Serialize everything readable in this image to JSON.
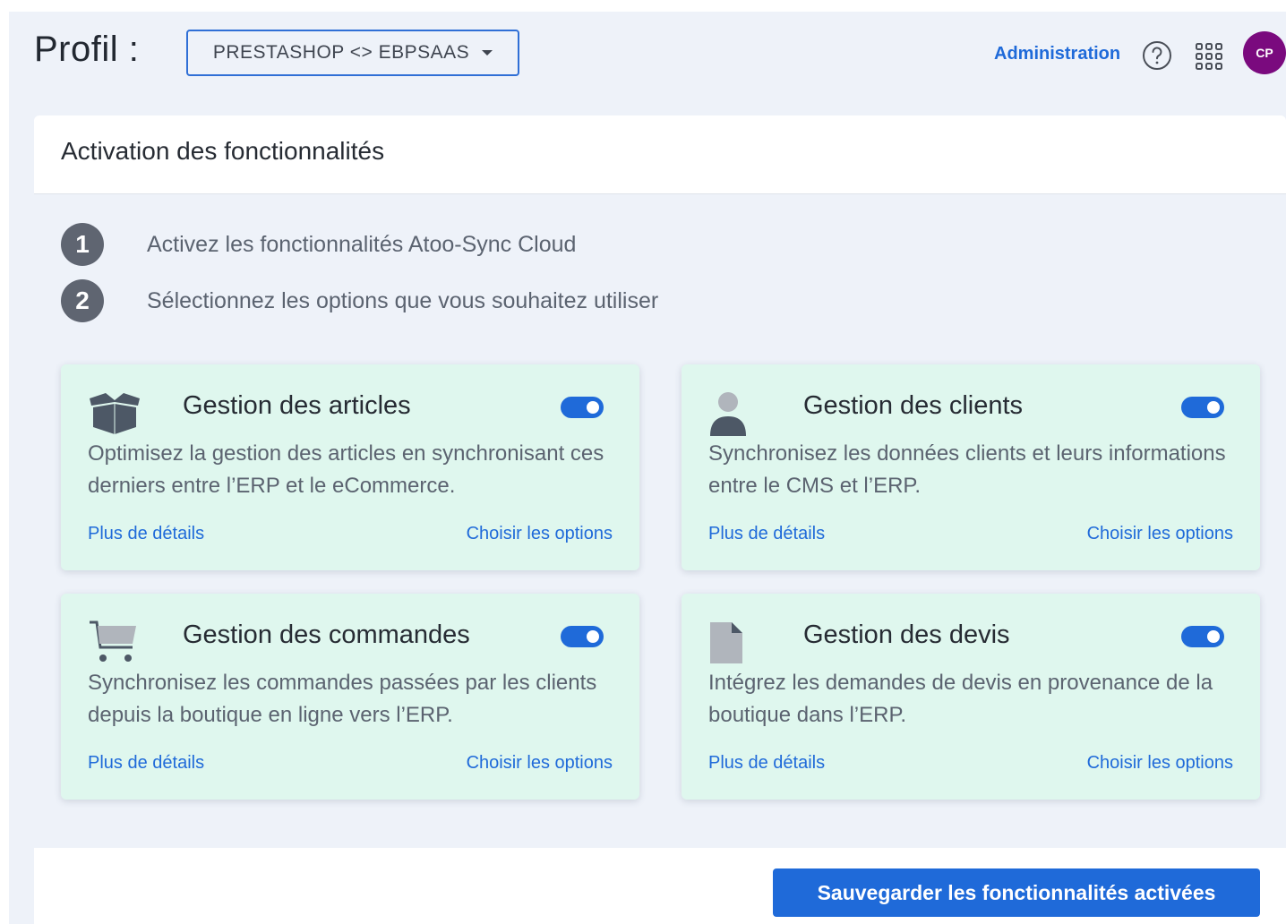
{
  "header": {
    "title": "Profil :",
    "profile_selected": "PRESTASHOP <> EBPSAAS",
    "admin_link": "Administration",
    "avatar_initials": "CP"
  },
  "panel": {
    "title": "Activation des fonctionnalités",
    "steps": [
      {
        "num": "1",
        "text": "Activez les fonctionnalités Atoo-Sync Cloud"
      },
      {
        "num": "2",
        "text": "Sélectionnez les options que vous souhaitez utiliser"
      }
    ],
    "cards": [
      {
        "icon": "box-icon",
        "title": "Gestion des articles",
        "enabled": true,
        "desc": "Optimisez la gestion des articles en synchronisant ces derniers entre l’ERP et le eCommerce.",
        "details_link": "Plus de détails",
        "options_link": "Choisir les options"
      },
      {
        "icon": "user-icon",
        "title": "Gestion des clients",
        "enabled": true,
        "desc": "Synchronisez les données clients et leurs informations entre le CMS et l’ERP.",
        "details_link": "Plus de détails",
        "options_link": "Choisir les options"
      },
      {
        "icon": "cart-icon",
        "title": "Gestion des commandes",
        "enabled": true,
        "desc": "Synchronisez les commandes passées par les clients depuis la boutique en ligne vers l’ERP.",
        "details_link": "Plus de détails",
        "options_link": "Choisir les options"
      },
      {
        "icon": "document-icon",
        "title": "Gestion des devis",
        "enabled": true,
        "desc": "Intégrez les demandes de devis en provenance de la boutique dans l’ERP.",
        "details_link": "Plus de détails",
        "options_link": "Choisir les options"
      }
    ],
    "save_label": "Sauvegarder les fonctionnalités activées"
  },
  "colors": {
    "accent": "#1f6ad9",
    "card_bg": "#dff7ee",
    "avatar_bg": "#7a0a7e",
    "step_badge": "#5f6571"
  }
}
